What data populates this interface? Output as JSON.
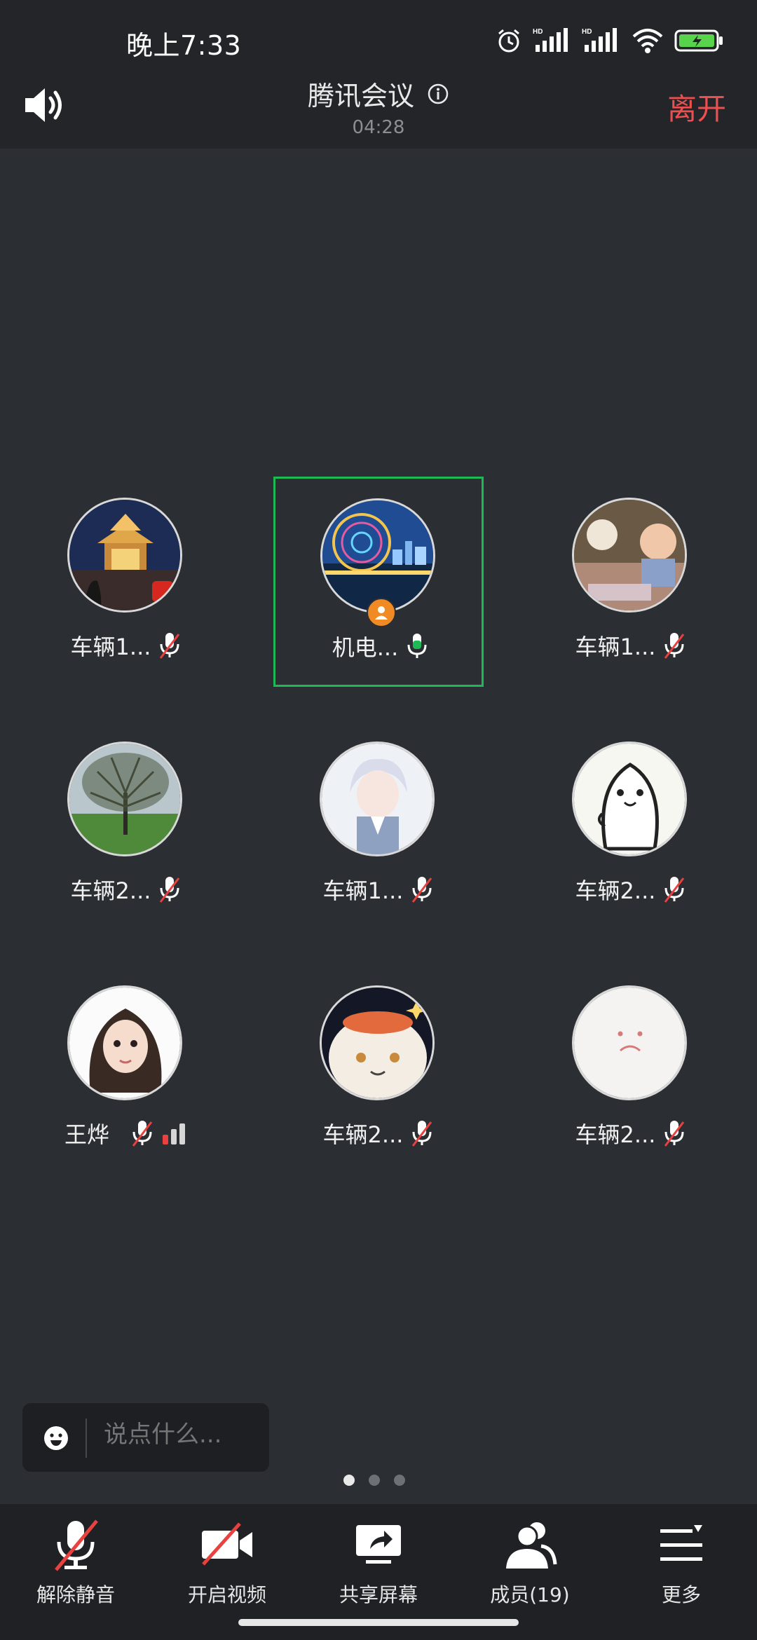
{
  "status": {
    "time": "晚上7:33",
    "battery_color": "#58d34b"
  },
  "header": {
    "title": "腾讯会议",
    "timer": "04:28",
    "leave_label": "离开"
  },
  "participants": [
    {
      "name": "车辆1...",
      "muted": true
    },
    {
      "name": "机电...",
      "muted": false,
      "speaking": true,
      "host": true
    },
    {
      "name": "车辆1...",
      "muted": true
    },
    {
      "name": "车辆2...",
      "muted": true
    },
    {
      "name": "车辆1...",
      "muted": true
    },
    {
      "name": "车辆2...",
      "muted": true
    },
    {
      "name": "王烨",
      "muted": true
    },
    {
      "name": "车辆2...",
      "muted": true
    },
    {
      "name": "车辆2...",
      "muted": true
    }
  ],
  "chat": {
    "placeholder": "说点什么..."
  },
  "pager": {
    "pages": 3,
    "current": 1
  },
  "toolbar": {
    "unmute_label": "解除静音",
    "video_label": "开启视频",
    "share_label": "共享屏幕",
    "members_label": "成员(19)",
    "more_label": "更多"
  },
  "colors": {
    "accent_active": "#1db954",
    "leave": "#ec4f4f",
    "mute_slash": "#e8413f"
  }
}
